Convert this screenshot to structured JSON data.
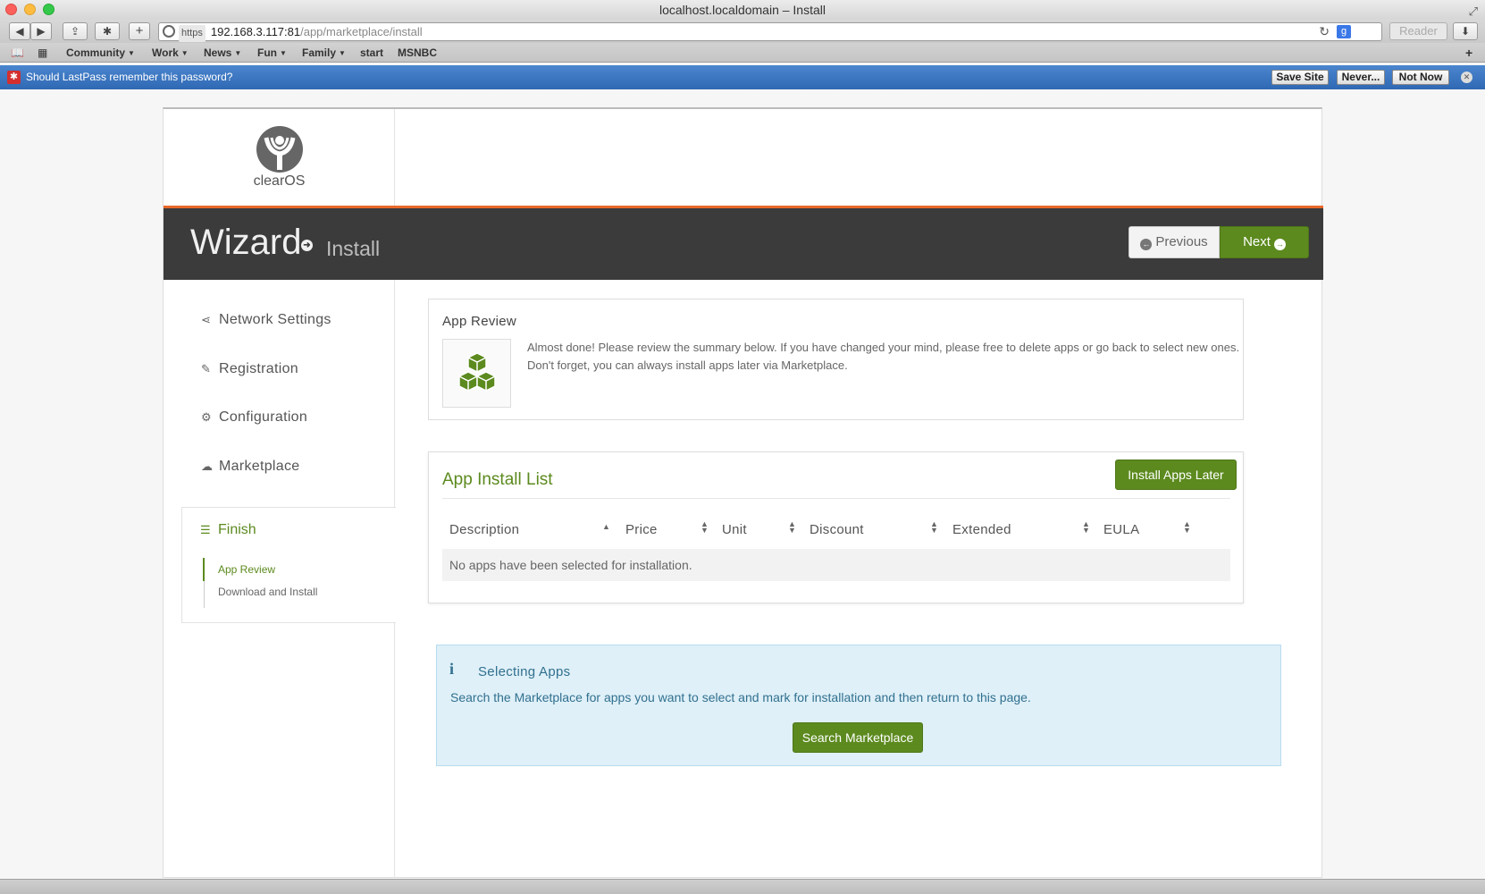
{
  "window": {
    "title": "localhost.localdomain – Install"
  },
  "toolbar": {
    "back": "◀",
    "forward": "▶",
    "share": "⇪",
    "extensions": "✱",
    "new_tab": "+",
    "url_protocol": "https",
    "url_host": "192.168.3.117:81",
    "url_path": "/app/marketplace/install",
    "reader": "Reader",
    "google": "g"
  },
  "bookmarks": [
    {
      "label": "Community",
      "menu": true
    },
    {
      "label": "Work",
      "menu": true
    },
    {
      "label": "News",
      "menu": true
    },
    {
      "label": "Fun",
      "menu": true
    },
    {
      "label": "Family",
      "menu": true
    },
    {
      "label": "start",
      "menu": false
    },
    {
      "label": "MSNBC",
      "menu": false
    }
  ],
  "lastpass": {
    "prompt": "Should LastPass remember this password?",
    "save_site": "Save Site",
    "never": "Never...",
    "not_now": "Not Now"
  },
  "logo": {
    "text": "clearOS"
  },
  "header": {
    "title": "Wizard",
    "subtitle": "Install",
    "previous": "Previous",
    "next": "Next"
  },
  "sidebar": {
    "items": [
      {
        "label": "Network Settings",
        "icon": "share-icon"
      },
      {
        "label": "Registration",
        "icon": "pencil-icon"
      },
      {
        "label": "Configuration",
        "icon": "gears-icon"
      },
      {
        "label": "Marketplace",
        "icon": "cloud-download-icon"
      }
    ],
    "finish": {
      "label": "Finish",
      "icon": "list-icon",
      "subitems": [
        "App Review",
        "Download and Install"
      ]
    }
  },
  "app_review": {
    "title": "App Review",
    "text": "Almost done! Please review the summary below. If you have changed your mind, please free to delete apps or go back to select new ones. Don't forget, you can always install apps later via Marketplace.",
    "icon": "cubes-icon"
  },
  "install_list": {
    "title": "App Install List",
    "button": "Install Apps Later",
    "columns": [
      "Description",
      "Price",
      "Unit",
      "Discount",
      "Extended",
      "EULA"
    ],
    "empty": "No apps have been selected for installation."
  },
  "info": {
    "title": "Selecting Apps",
    "text": "Search the Marketplace for apps you want to select and mark for installation and then return to this page.",
    "button": "Search Marketplace"
  },
  "colors": {
    "accent": "#5c8a1e",
    "header": "#3b3b3b",
    "orange": "#e8672a",
    "info_bg": "#dff0f8",
    "info_text": "#31708f"
  }
}
